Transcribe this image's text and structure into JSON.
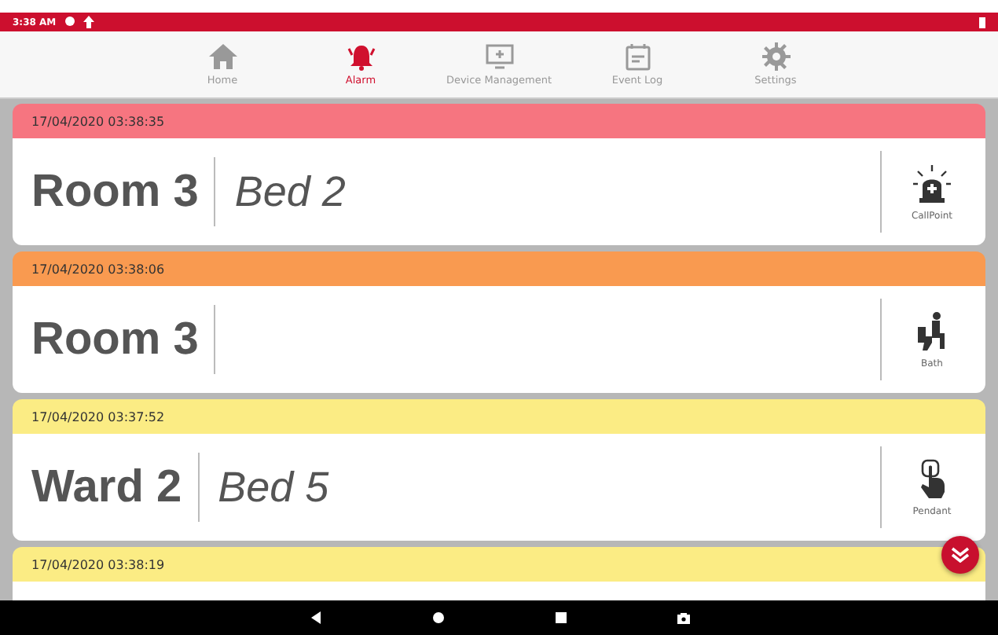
{
  "status_bar": {
    "time": "3:38 AM"
  },
  "tabs": [
    {
      "label": "Home",
      "kind": "home",
      "selected": false
    },
    {
      "label": "Alarm",
      "kind": "alarm",
      "selected": true
    },
    {
      "label": "Device Management",
      "kind": "device",
      "selected": false
    },
    {
      "label": "Event Log",
      "kind": "log",
      "selected": false
    },
    {
      "label": "Settings",
      "kind": "settings",
      "selected": false
    }
  ],
  "alarms": [
    {
      "time": "17/04/2020 03:38:35",
      "color": "#f67580",
      "room": "Room 3",
      "bed": "Bed 2",
      "device": "CallPoint",
      "kind": "callpoint"
    },
    {
      "time": "17/04/2020 03:38:06",
      "color": "#f99a50",
      "room": "Room 3",
      "device": "Bath",
      "kind": "bath"
    },
    {
      "time": "17/04/2020 03:37:52",
      "color": "#fbec84",
      "room": "Ward 2",
      "bed": "Bed 5",
      "device": "Pendant",
      "kind": "pendant"
    },
    {
      "time": "17/04/2020 03:38:19",
      "color": "#fbec84"
    }
  ]
}
